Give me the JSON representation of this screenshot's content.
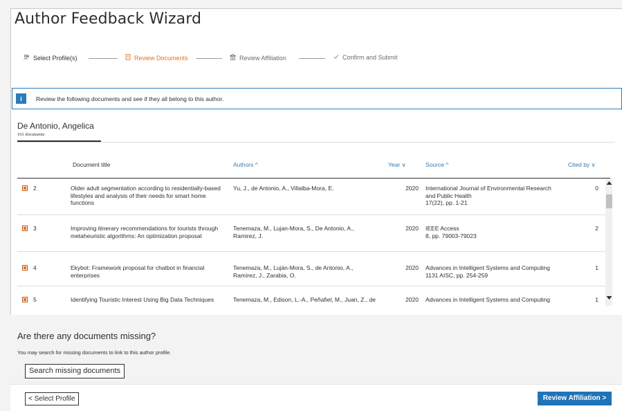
{
  "window": {
    "title": "Author Feedback Wizard"
  },
  "steps": [
    {
      "label": "Select Profile(s)",
      "icon": "people-icon",
      "glyph": "ℝ",
      "state": "done"
    },
    {
      "label": "Review Documents",
      "icon": "document-icon",
      "glyph": "□",
      "state": "active"
    },
    {
      "label": "Review Affiliation",
      "icon": "building-icon",
      "glyph": "⌂",
      "state": "pending"
    },
    {
      "label": "Confirm and Submit",
      "icon": "check-icon",
      "glyph": "✓",
      "state": "pending"
    }
  ],
  "info": {
    "badge": "i",
    "message": "Review the following documents and see if they all belong to this author."
  },
  "author": {
    "name": "De Antonio, Angelica",
    "count": "101 documents"
  },
  "table": {
    "headers": {
      "title": "Document title",
      "authors": "Authors ^",
      "year": "Year ∨",
      "source": "Source ^",
      "cited": "Cited by ∨"
    },
    "rows": [
      {
        "num": "2",
        "title": "Older adult segmentation according to residentially-based lifestyles and analysis of their needs for smart home functions",
        "authors": "Yu, J., de Antonio, A., Villalba-Mora, E.",
        "year": "2020",
        "source_lines": [
          "International Journal of Environmental Research and Public Health",
          "17(22), pp. 1-21"
        ],
        "cited": "0"
      },
      {
        "num": "3",
        "title": "Improving itinerary recommendations for tourists through metaheuristic algorithms: An optimization proposal",
        "authors": "Tenemaza, M., Lujan-Mora, S., De Antonio, A., Ramirez, J.",
        "year": "2020",
        "source_lines": [
          "IEEE Access",
          "8, pp. 79003-79023"
        ],
        "cited": "2"
      },
      {
        "num": "4",
        "title": "Ekybot: Framework proposal for chatbot in financial enterprises",
        "authors": "Tenemaza, M., Luján-Mora, S., de Antonio, A., Ramírez, J., Zarabia, O.",
        "year": "2020",
        "source_lines": [
          "Advances in Intelligent Systems and Computing",
          "1131 AISC, pp. 254-259"
        ],
        "cited": "1"
      },
      {
        "num": "5",
        "title": "Identifying Touristic Interest Using Big Data Techniques",
        "authors": "Tenemaza, M., Edison, L.-A., Peñafiel, M., Juan, Z., de",
        "year": "2020",
        "source_lines": [
          "Advances in Intelligent Systems and Computing"
        ],
        "cited": "1"
      }
    ]
  },
  "missing": {
    "title": "Are there any documents missing?",
    "description": "You may search for missing documents to link to this author profile.",
    "search_label": "Search missing documents"
  },
  "footer": {
    "back_label": "< Select Profile",
    "next_label": "Review Affiliation >"
  },
  "colors": {
    "accent": "#e9711c",
    "brand": "#1f73b7",
    "info": "#2b7bb9"
  }
}
